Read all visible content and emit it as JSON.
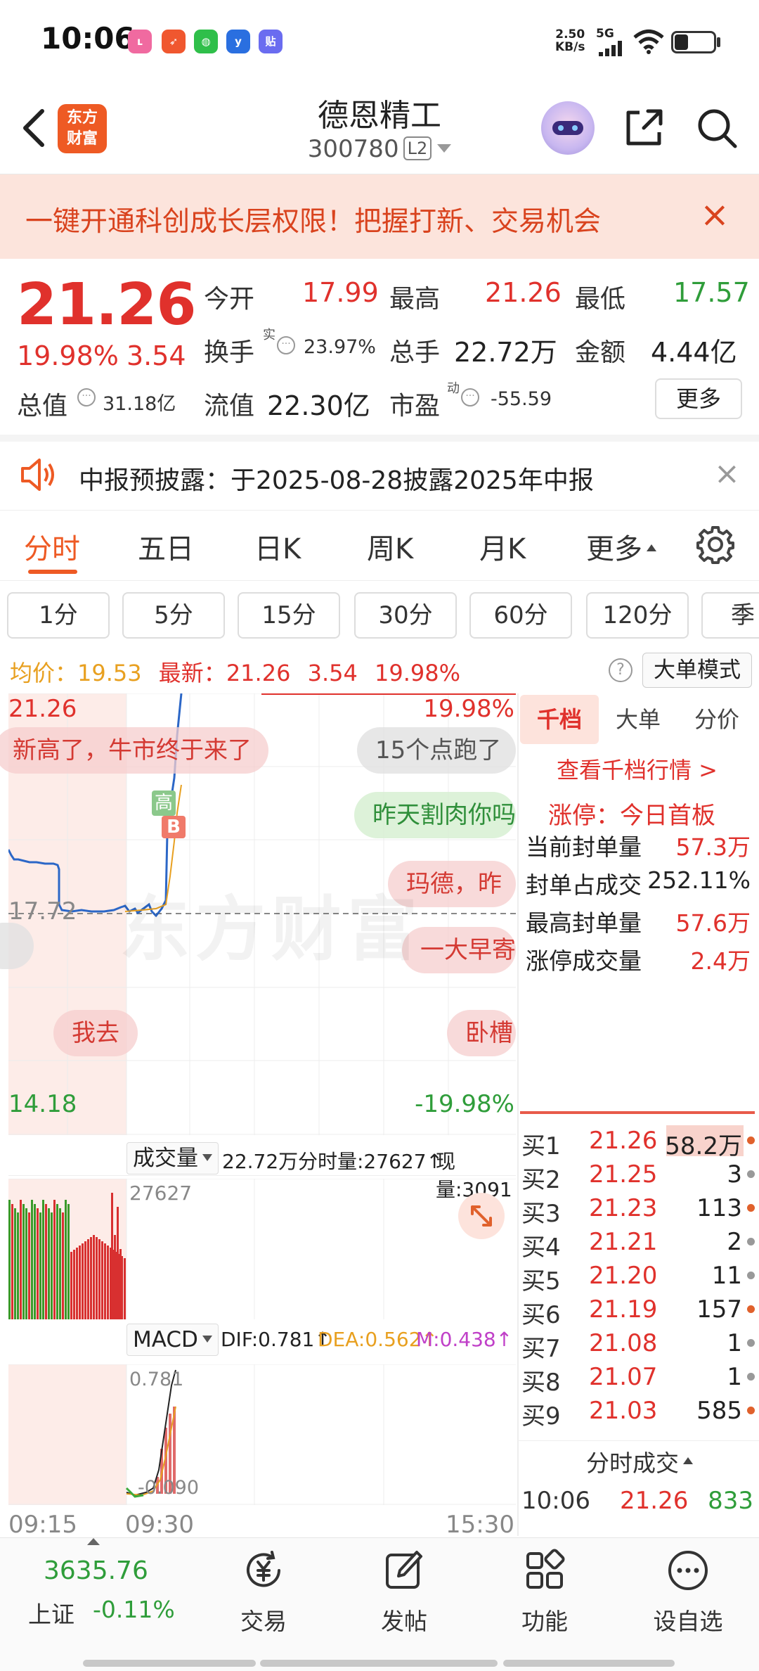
{
  "status_bar": {
    "time": "10:06",
    "net_speed_value": "2.50",
    "net_speed_unit": "KB/s",
    "network": "5G",
    "app_icons": [
      "lalala",
      "send",
      "wechat",
      "yp",
      "贴"
    ],
    "battery_level": 0.35
  },
  "header": {
    "logo_line1": "东方",
    "logo_line2": "财富",
    "stock_name": "德恩精工",
    "stock_code": "300780",
    "level_badge": "L2"
  },
  "promo": {
    "text": "一键开通科创成长层权限！把握打新、交易机会",
    "close": "×"
  },
  "quote": {
    "price": "21.26",
    "change_pct": "19.98%",
    "change_amt": "3.54",
    "open_label": "今开",
    "open": "17.99",
    "high_label": "最高",
    "high": "21.26",
    "low_label": "最低",
    "low": "17.57",
    "turnover_label": "换手",
    "turnover_sup": "实",
    "turnover": "23.97%",
    "volume_label": "总手",
    "volume": "22.72万",
    "amount_label": "金额",
    "amount": "4.44亿",
    "mcap_label": "总值",
    "mcap": "31.18亿",
    "float_label": "流值",
    "float": "22.30亿",
    "pe_label": "市盈",
    "pe_sup": "动",
    "pe": "-55.59",
    "more_btn": "更多"
  },
  "notice": {
    "text": "中报预披露：于2025-08-28披露2025年中报",
    "close": "×"
  },
  "period_tabs": [
    "分时",
    "五日",
    "日K",
    "周K",
    "月K",
    "更多"
  ],
  "minute_buttons": [
    "1分",
    "5分",
    "15分",
    "30分",
    "60分",
    "120分",
    "季"
  ],
  "avg_row": {
    "avg_label": "均价：",
    "avg": "19.53",
    "latest_label": "最新：",
    "latest": "21.26",
    "chg": "3.54",
    "pct": "19.98%",
    "help": "?",
    "bigorder_btn": "大单模式"
  },
  "chart": {
    "price_high": "21.26",
    "price_mid": "17.72",
    "price_low": "14.18",
    "pct_high": "19.98%",
    "pct_low": "-19.98%",
    "time_start": "09:15",
    "time_open": "09:30",
    "time_end": "15:30",
    "marker_high": "高",
    "marker_b": "B",
    "watermark": "东方财富",
    "bubbles": [
      {
        "text": "新高了，牛市终于来了",
        "style": "red"
      },
      {
        "text": "15个点跑了",
        "style": "gray"
      },
      {
        "text": "昨天割肉你吗",
        "style": "green"
      },
      {
        "text": "玛德，昨",
        "style": "red"
      },
      {
        "text": "一大早寄",
        "style": "red"
      },
      {
        "text": "我去",
        "style": "red"
      },
      {
        "text": "卧槽",
        "style": "red"
      }
    ],
    "volume_selector": "成交量",
    "volume_total": "22.72万",
    "minute_volume": "分时量:27627↑",
    "current_volume": "现量:3091",
    "volume_axis_max": "27627",
    "macd_selector": "MACD",
    "dif": "DIF:0.781↑",
    "dea": "DEA:0.562↑",
    "m": "M:0.438↑",
    "macd_top": "0.781",
    "macd_bottom": "-0.090"
  },
  "right_panel": {
    "tabs": [
      "千档",
      "大单",
      "分价"
    ],
    "detail_link": "查看千档行情 >",
    "limit_status": "涨停：今日首板",
    "stats": [
      {
        "label": "当前封单量",
        "value": "57.3万",
        "color": "red"
      },
      {
        "label": "封单占成交",
        "value": "252.11%",
        "color": "black"
      },
      {
        "label": "最高封单量",
        "value": "57.6万",
        "color": "red"
      },
      {
        "label": "涨停成交量",
        "value": "2.4万",
        "color": "red"
      }
    ],
    "bids": [
      {
        "label": "买1",
        "price": "21.26",
        "qty": "58.2万",
        "dot": "#e0612c"
      },
      {
        "label": "买2",
        "price": "21.25",
        "qty": "3",
        "dot": "#999999"
      },
      {
        "label": "买3",
        "price": "21.23",
        "qty": "113",
        "dot": "#e0612c"
      },
      {
        "label": "买4",
        "price": "21.21",
        "qty": "2",
        "dot": "#999999"
      },
      {
        "label": "买5",
        "price": "21.20",
        "qty": "11",
        "dot": "#999999"
      },
      {
        "label": "买6",
        "price": "21.19",
        "qty": "157",
        "dot": "#e0612c"
      },
      {
        "label": "买7",
        "price": "21.08",
        "qty": "1",
        "dot": "#999999"
      },
      {
        "label": "买8",
        "price": "21.07",
        "qty": "1",
        "dot": "#999999"
      },
      {
        "label": "买9",
        "price": "21.03",
        "qty": "585",
        "dot": "#e0612c"
      }
    ],
    "ticks_header": "分时成交",
    "ticks": [
      {
        "time": "10:06",
        "price": "21.26",
        "vol": "833"
      }
    ]
  },
  "bottom_nav": {
    "index_value": "3635.76",
    "index_name": "上证",
    "index_change": "-0.11%",
    "items": [
      "交易",
      "发帖",
      "功能",
      "设自选"
    ]
  }
}
